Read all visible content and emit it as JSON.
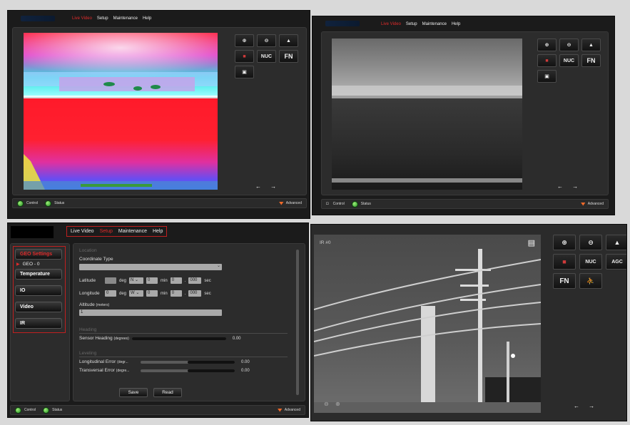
{
  "menu": [
    "Live Video",
    "Setup",
    "Maintenance",
    "Help"
  ],
  "toolbar": {
    "nuc": "NUC",
    "fn": "FN",
    "agc": "AGC"
  },
  "footer": {
    "control": "Control",
    "status": "Status",
    "advanced": "Advanced"
  },
  "setup": {
    "sidebar": {
      "geo_settings": "GEO Settings",
      "geo_item": "GEO - 0",
      "temperature": "Temperature",
      "io": "IO",
      "video": "Video",
      "ir": "IR"
    },
    "location_heading": "Location",
    "coordinate_type_label": "Coordinate Type",
    "latitude": {
      "label": "Latitude",
      "deg_label": "deg",
      "dir": "N",
      "min_value": "0",
      "min_label": "min",
      "sec_a": "0",
      "sec_b": "000",
      "sec_label": "sec"
    },
    "longitude": {
      "label": "Longitude",
      "deg_value": "0",
      "deg_label": "deg",
      "dir": "W",
      "min_value": "0",
      "min_label": "min",
      "sec_a": "0",
      "sec_b": "000",
      "sec_label": "sec"
    },
    "altitude": {
      "label": "Altitude",
      "unit": "(meters)",
      "value": "1"
    },
    "heading_section": "Heading",
    "sensor_heading": {
      "label": "Sensor Heading",
      "unit": "(degrees)",
      "value": "0.00"
    },
    "leveling_section": "Leveling",
    "longitudinal_error": {
      "label": "Longitudinal Error",
      "unit": "(degr...",
      "value": "0.00"
    },
    "transversal_error": {
      "label": "Transversal Error",
      "unit": "(degre...",
      "value": "0.00"
    },
    "save": "Save",
    "read": "Read"
  },
  "ir_feed": {
    "label": "IR #0"
  },
  "colors": {
    "active_menu": "#e02b2b",
    "status_green": "#2fb52f",
    "advanced_orange": "#f06a2a"
  }
}
